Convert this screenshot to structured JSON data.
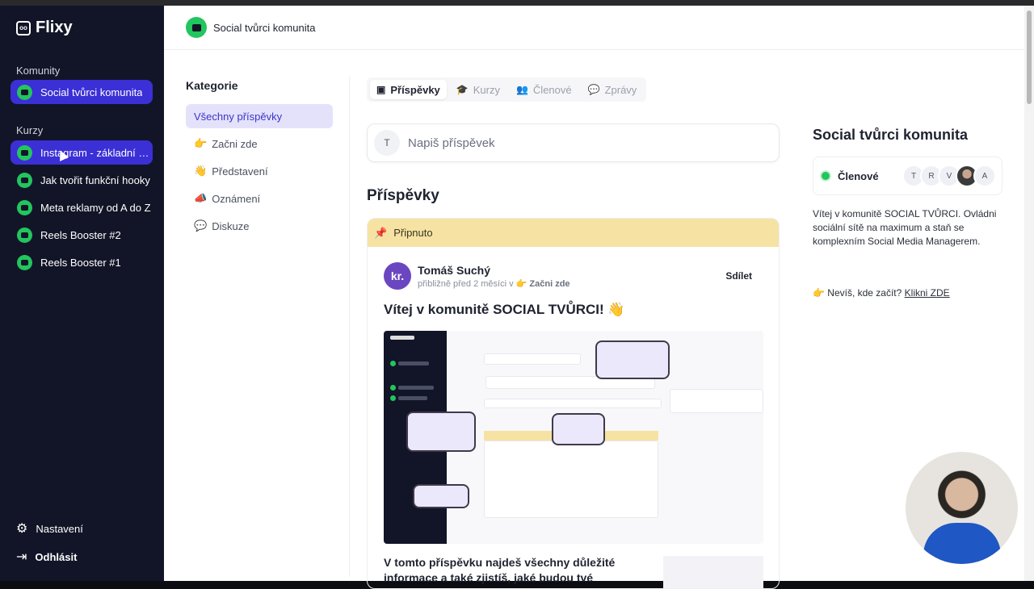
{
  "app": {
    "name": "Flixy",
    "logo_mark": "oo"
  },
  "sidebar": {
    "communities_heading": "Komunity",
    "communities": [
      {
        "label": "Social tvůrci komunita",
        "icon": "chat-bubble-icon",
        "active": true
      }
    ],
    "courses_heading": "Kurzy",
    "courses": [
      {
        "label": "Instagram - základní kurz",
        "icon": "chat-bubble-icon",
        "active": true
      },
      {
        "label": "Jak tvořit funkční hooky",
        "icon": "chat-bubble-icon"
      },
      {
        "label": "Meta reklamy od A do Z",
        "icon": "chat-bubble-icon"
      },
      {
        "label": "Reels Booster #2",
        "icon": "chat-bubble-icon"
      },
      {
        "label": "Reels Booster #1",
        "icon": "chat-bubble-icon"
      }
    ],
    "settings_label": "Nastavení",
    "logout_label": "Odhlásit"
  },
  "header": {
    "title": "Social tvůrci komunita"
  },
  "categories": {
    "title": "Kategorie",
    "items": [
      {
        "emoji": "",
        "label": "Všechny příspěvky",
        "active": true
      },
      {
        "emoji": "👉",
        "label": "Začni zde"
      },
      {
        "emoji": "👋",
        "label": "Představení"
      },
      {
        "emoji": "📣",
        "label": "Oznámení"
      },
      {
        "emoji": "💬",
        "label": "Diskuze"
      }
    ]
  },
  "tabs": [
    {
      "label": "Příspěvky",
      "icon": "posts-icon",
      "glyph": "▣",
      "active": true
    },
    {
      "label": "Kurzy",
      "icon": "graduation-cap-icon",
      "glyph": "🎓"
    },
    {
      "label": "Členové",
      "icon": "users-icon",
      "glyph": "👥"
    },
    {
      "label": "Zprávy",
      "icon": "message-icon",
      "glyph": "💬"
    }
  ],
  "composer": {
    "avatar_initial": "T",
    "placeholder": "Napiš příspěvek"
  },
  "posts": {
    "title": "Příspěvky",
    "pinned_label": "Připnuto",
    "pinned_post": {
      "author": "Tomáš Suchý",
      "author_initials": "kr.",
      "meta_prefix": "přibližně před 2 měsíci v",
      "meta_category": "👉 Začni zde",
      "share_label": "Sdílet",
      "title": "Vítej v komunitě SOCIAL TVŮRCI! 👋",
      "excerpt": "V tomto příspěvku najdeš všechny důležité informace a také zjistíš, jaké budou tvé"
    }
  },
  "right_panel": {
    "title": "Social tvůrci komunita",
    "members_label": "Členové",
    "member_initials": [
      "T",
      "R",
      "V",
      "",
      "A"
    ],
    "description": "Vítej v komunitě SOCIAL TVŮRCI. Ovládni sociální sítě na maximum a staň se komplexním Social Media Managerem.",
    "hint_prefix": "👉 Nevíš, kde začít?",
    "hint_link": "Klikni ZDE"
  },
  "colors": {
    "sidebar_bg": "#121527",
    "accent": "#3b2fd6",
    "green": "#22c55e",
    "pinned_bg": "#f6e3a3"
  }
}
